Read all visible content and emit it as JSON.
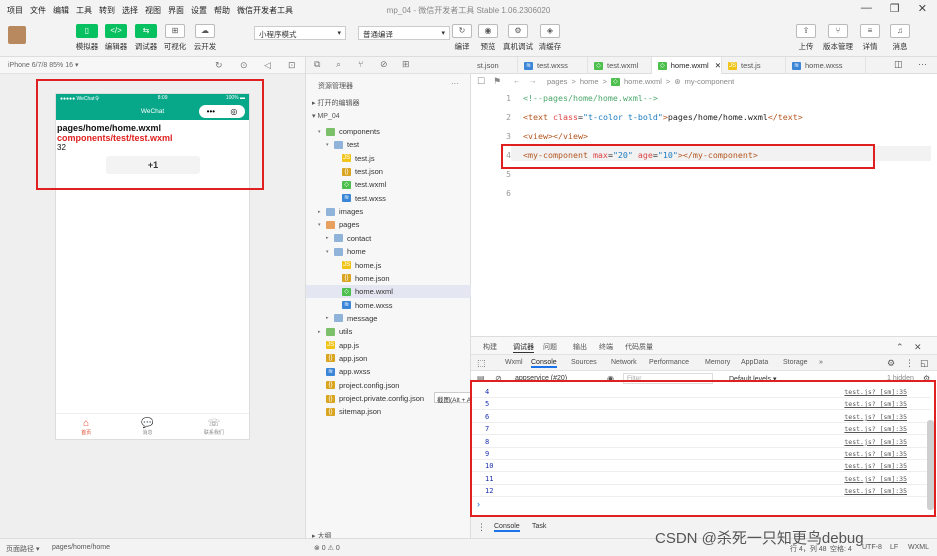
{
  "menubar": {
    "items": [
      "项目",
      "文件",
      "编辑",
      "工具",
      "转到",
      "选择",
      "视图",
      "界面",
      "设置",
      "帮助",
      "微信开发者工具"
    ],
    "title": "mp_04 - 微信开发者工具 Stable 1.06.2306020"
  },
  "toolbar": {
    "buttons": [
      {
        "label": "模拟器",
        "glyph": "▯"
      },
      {
        "label": "编辑器",
        "glyph": "</>"
      },
      {
        "label": "调试器",
        "glyph": "⇆"
      },
      {
        "label": "可视化",
        "glyph": "⊞"
      },
      {
        "label": "云开发",
        "glyph": "☁"
      }
    ],
    "mode": "小程序模式",
    "compile": "普通编译",
    "mid_buttons": [
      {
        "label": "编译",
        "glyph": "↻"
      },
      {
        "label": "预览",
        "glyph": "◉"
      },
      {
        "label": "真机调试",
        "glyph": "⚙"
      },
      {
        "label": "清缓存",
        "glyph": "◈"
      }
    ],
    "right_buttons": [
      {
        "label": "上传",
        "glyph": "⇪"
      },
      {
        "label": "版本管理",
        "glyph": "⑂"
      },
      {
        "label": "详情",
        "glyph": "≡"
      },
      {
        "label": "消息",
        "glyph": "♫"
      }
    ],
    "active_color": "#07c160"
  },
  "simulator": {
    "device": "iPhone 6/7/8 85% 16 ▾",
    "status_left": "●●●●● WeChat令",
    "status_time": "8:09",
    "status_right": "100% ▬",
    "nav_title": "WeChat",
    "capsule_dots": "•••",
    "capsule_target": "◎",
    "line1": "pages/home/home.wxml",
    "line2": "components/test/test.wxml",
    "count": "32",
    "button": "+1",
    "tabs": [
      {
        "label": "首页",
        "icon": "⌂"
      },
      {
        "label": "消息",
        "icon": "💬"
      },
      {
        "label": "联系我们",
        "icon": "☏"
      }
    ],
    "accent": "#07a88a"
  },
  "explorer": {
    "title": "资源管理器",
    "more": "···",
    "open_editors": "打开的编辑器",
    "project": "MP_04",
    "files": [
      {
        "name": "components",
        "type": "folder",
        "depth": 1,
        "arrow": "▾"
      },
      {
        "name": "test",
        "type": "folder",
        "depth": 2,
        "arrow": "▾"
      },
      {
        "name": "test.js",
        "type": "js",
        "depth": 3
      },
      {
        "name": "test.json",
        "type": "json",
        "depth": 3
      },
      {
        "name": "test.wxml",
        "type": "wxml",
        "depth": 3
      },
      {
        "name": "test.wxss",
        "type": "wxss",
        "depth": 3
      },
      {
        "name": "images",
        "type": "folder",
        "depth": 1,
        "arrow": "▸"
      },
      {
        "name": "pages",
        "type": "folder",
        "depth": 1,
        "arrow": "▾"
      },
      {
        "name": "contact",
        "type": "folder",
        "depth": 2,
        "arrow": "▸"
      },
      {
        "name": "home",
        "type": "folder",
        "depth": 2,
        "arrow": "▾"
      },
      {
        "name": "home.js",
        "type": "js",
        "depth": 3
      },
      {
        "name": "home.json",
        "type": "json",
        "depth": 3
      },
      {
        "name": "home.wxml",
        "type": "wxml",
        "depth": 3,
        "selected": true
      },
      {
        "name": "home.wxss",
        "type": "wxss",
        "depth": 3
      },
      {
        "name": "message",
        "type": "folder",
        "depth": 2,
        "arrow": "▸"
      },
      {
        "name": "utils",
        "type": "folder",
        "depth": 1,
        "arrow": "▸"
      },
      {
        "name": "app.js",
        "type": "js",
        "depth": 1
      },
      {
        "name": "app.json",
        "type": "json",
        "depth": 1
      },
      {
        "name": "app.wxss",
        "type": "wxss",
        "depth": 1
      },
      {
        "name": "project.config.json",
        "type": "json",
        "depth": 1
      },
      {
        "name": "project.private.config.json",
        "type": "json",
        "depth": 1
      },
      {
        "name": "sitemap.json",
        "type": "json",
        "depth": 1
      }
    ],
    "tooltip": "截图(Alt + A)",
    "outline": "大纲"
  },
  "editor_tabs": [
    {
      "name": "st.json",
      "type": "json"
    },
    {
      "name": "test.wxss",
      "type": "wxss"
    },
    {
      "name": "test.wxml",
      "type": "wxml"
    },
    {
      "name": "home.wxml",
      "type": "wxml",
      "active": true
    },
    {
      "name": "test.js",
      "type": "js"
    },
    {
      "name": "home.wxss",
      "type": "wxss"
    }
  ],
  "breadcrumb": {
    "parts": [
      "pages",
      "home",
      "home.wxml",
      "my-component"
    ],
    "sep": ">"
  },
  "code_lines": [
    {
      "n": "1",
      "text": "<!--pages/home/home.wxml-->"
    },
    {
      "n": "2",
      "text": "<text class=\"t-color t-bold\">pages/home/home.wxml</text>"
    },
    {
      "n": "3",
      "text": "<view></view>"
    },
    {
      "n": "4",
      "text": "<my-component max=\"20\" age=\"10\"></my-component>"
    },
    {
      "n": "5",
      "text": ""
    },
    {
      "n": "6",
      "text": ""
    }
  ],
  "devtools": {
    "top_tabs": [
      "构建",
      "调试器",
      "问题",
      "输出",
      "终端",
      "代码质量"
    ],
    "panel_tabs": [
      "Wxml",
      "Console",
      "Sources",
      "Network",
      "Performance",
      "Memory",
      "AppData",
      "Storage",
      "»"
    ],
    "context": "appservice (#20)",
    "filter_placeholder": "Filter",
    "levels": "Default levels ▾",
    "hidden": "1 hidden",
    "logs": [
      {
        "v": "4",
        "src": "test.js? [sm]:35"
      },
      {
        "v": "5",
        "src": "test.js? [sm]:35"
      },
      {
        "v": "6",
        "src": "test.js? [sm]:35"
      },
      {
        "v": "7",
        "src": "test.js? [sm]:35"
      },
      {
        "v": "8",
        "src": "test.js? [sm]:35"
      },
      {
        "v": "9",
        "src": "test.js? [sm]:35"
      },
      {
        "v": "10",
        "src": "test.js? [sm]:35"
      },
      {
        "v": "11",
        "src": "test.js? [sm]:35"
      },
      {
        "v": "12",
        "src": "test.js? [sm]:35"
      }
    ],
    "prompt": "›",
    "drawer_tabs": [
      "Console",
      "Task"
    ]
  },
  "statusbar": {
    "path_label": "页面路径 ▾",
    "path": "pages/home/home",
    "errors": "⊗ 0 ⚠ 0",
    "position": "行 4，列 48",
    "spaces": "空格: 4",
    "encoding": "UTF-8",
    "eol": "LF",
    "lang": "WXML"
  },
  "watermark": "CSDN @杀死一只知更鸟debug",
  "colors": {
    "js": "#f0c419",
    "json": "#d9a520",
    "wxml": "#4cbf4c",
    "wxss": "#3c86d8",
    "folder": "#8fb3d9",
    "red": "#e02020"
  }
}
